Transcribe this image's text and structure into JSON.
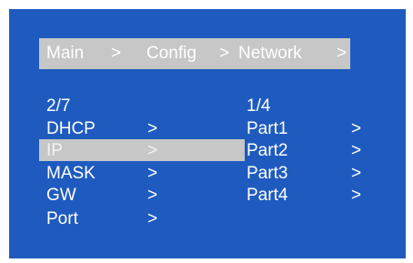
{
  "breadcrumb": {
    "items": [
      "Main",
      "Config",
      "Network"
    ],
    "separator": ">"
  },
  "left_menu": {
    "page": "2/7",
    "items": [
      {
        "label": "DHCP",
        "arrow": ">"
      },
      {
        "label": "IP",
        "arrow": ">",
        "selected": true
      },
      {
        "label": "MASK",
        "arrow": ">"
      },
      {
        "label": "GW",
        "arrow": ">"
      },
      {
        "label": "Port",
        "arrow": ">"
      }
    ]
  },
  "right_menu": {
    "page": "1/4",
    "items": [
      {
        "label": "Part1",
        "arrow": ">"
      },
      {
        "label": "Part2",
        "arrow": ">"
      },
      {
        "label": "Part3",
        "arrow": ">"
      },
      {
        "label": "Part4",
        "arrow": ">"
      }
    ]
  },
  "colors": {
    "background": "#1f5bbf",
    "highlight": "#c7c7c7",
    "text": "#ffffff"
  }
}
